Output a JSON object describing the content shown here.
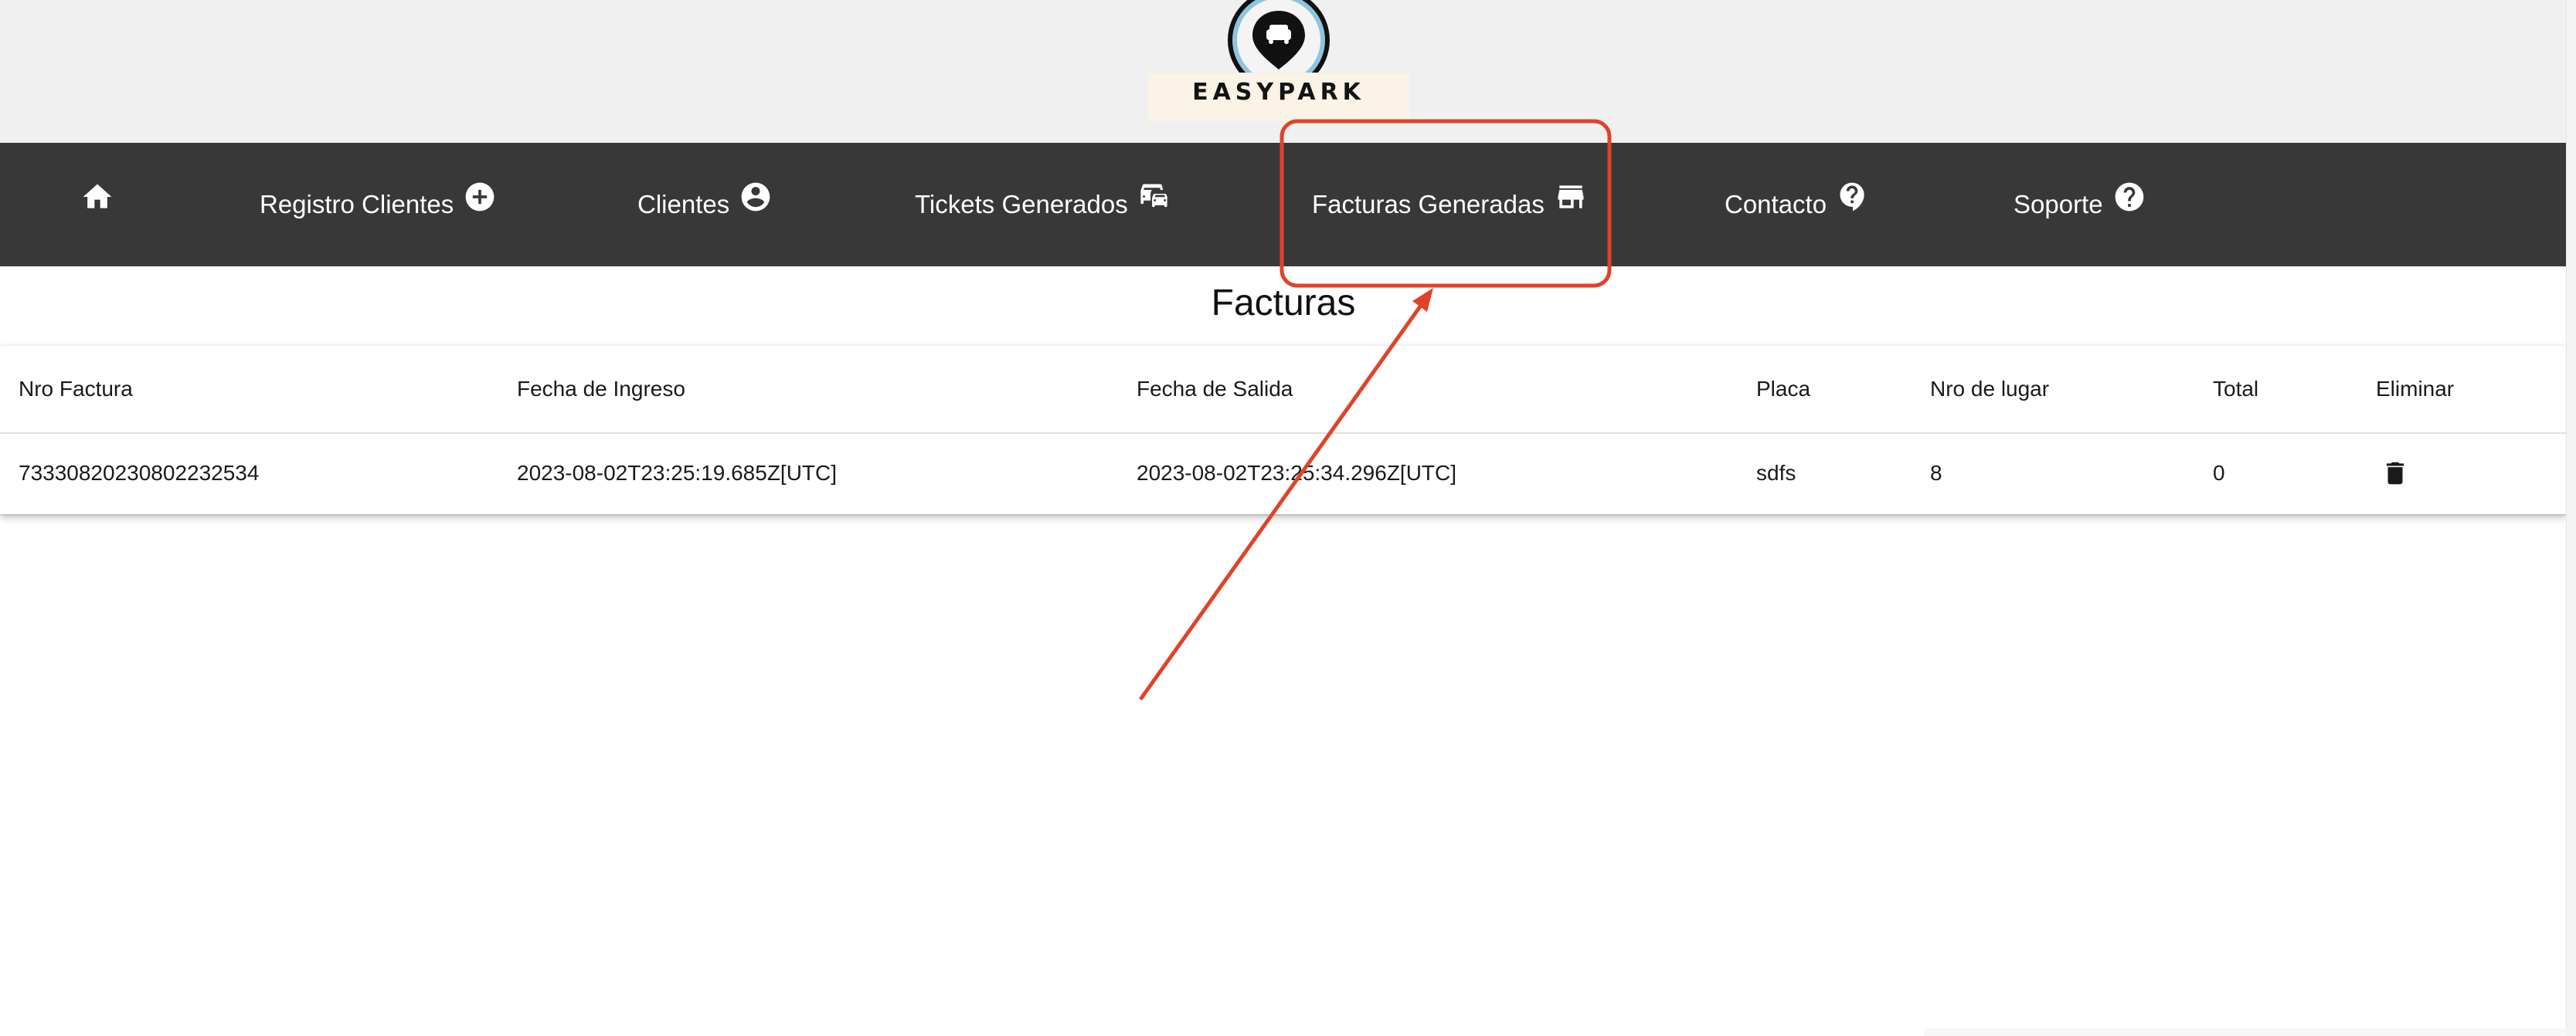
{
  "brand": {
    "name": "EASYPARK",
    "colors": {
      "header_bg": "#f0f0f0",
      "navbar_bg": "#383838",
      "badge_bg": "#fbf3e6",
      "annotation": "#e0432a"
    }
  },
  "navbar": {
    "items": [
      {
        "label": "",
        "icon": "home-icon"
      },
      {
        "label": "Registro Clientes",
        "icon": "add-circle-icon"
      },
      {
        "label": "Clientes",
        "icon": "account-circle-icon"
      },
      {
        "label": "Tickets Generados",
        "icon": "cars-icon"
      },
      {
        "label": "Facturas Generadas",
        "icon": "store-icon"
      },
      {
        "label": "Contacto",
        "icon": "help-bubble-icon"
      },
      {
        "label": "Soporte",
        "icon": "help-circle-icon"
      }
    ]
  },
  "page": {
    "title": "Facturas"
  },
  "table": {
    "columns": [
      "Nro Factura",
      "Fecha de Ingreso",
      "Fecha de Salida",
      "Placa",
      "Nro de lugar",
      "Total",
      "Eliminar"
    ],
    "rows": [
      {
        "nro_factura": "73330820230802232534",
        "fecha_ingreso": "2023-08-02T23:25:19.685Z[UTC]",
        "fecha_salida": "2023-08-02T23:25:34.296Z[UTC]",
        "placa": "sdfs",
        "nro_lugar": "8",
        "total": "0",
        "eliminar_icon": "trash-icon"
      }
    ]
  }
}
